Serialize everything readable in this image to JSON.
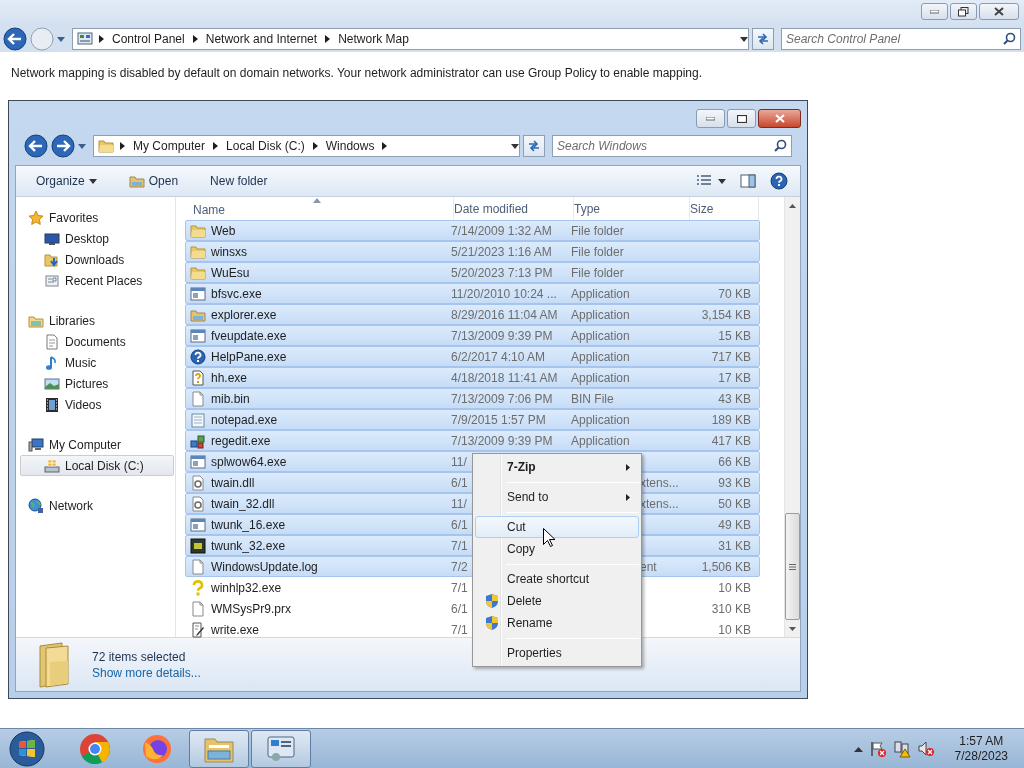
{
  "address_bar": {
    "crumbs": [
      "Control Panel",
      "Network and Internet",
      "Network Map"
    ]
  },
  "search": {
    "placeholder": "Search Control Panel"
  },
  "message": "Network mapping is disabled by default on domain networks. Your network administrator can use Group Policy to enable mapping.",
  "explorer": {
    "address_bar": {
      "crumbs": [
        "My Computer",
        "Local Disk (C:)",
        "Windows"
      ]
    },
    "search": {
      "placeholder": "Search Windows"
    },
    "toolbar": [
      {
        "label": "Organize",
        "kind": "menu"
      },
      {
        "label": "Open",
        "kind": "open"
      },
      {
        "label": "New folder",
        "kind": "plain"
      }
    ],
    "sidebar": [
      {
        "label": "Favorites",
        "kind": "star",
        "selected": false,
        "children": [
          {
            "label": "Desktop",
            "kind": "desktop",
            "selected": false
          },
          {
            "label": "Downloads",
            "kind": "downloads",
            "selected": false
          },
          {
            "label": "Recent Places",
            "kind": "recent",
            "selected": false
          }
        ]
      },
      {
        "label": "Libraries",
        "kind": "library",
        "selected": false,
        "children": [
          {
            "label": "Documents",
            "kind": "documents",
            "selected": false
          },
          {
            "label": "Music",
            "kind": "music",
            "selected": false
          },
          {
            "label": "Pictures",
            "kind": "pictures",
            "selected": false
          },
          {
            "label": "Videos",
            "kind": "videos",
            "selected": false
          }
        ]
      },
      {
        "label": "My Computer",
        "kind": "computer",
        "selected": false,
        "children": [
          {
            "label": "Local Disk (C:)",
            "kind": "disk",
            "selected": true
          }
        ]
      },
      {
        "label": "Network",
        "kind": "network",
        "selected": false
      }
    ],
    "columns": [
      {
        "label": "Name",
        "sorted": true
      },
      {
        "label": "Date modified",
        "sorted": false
      },
      {
        "label": "Type",
        "sorted": false
      },
      {
        "label": "Size",
        "sorted": false
      }
    ],
    "rows": [
      {
        "name": "Web",
        "date": "7/14/2009 1:32 AM",
        "type": "File folder",
        "kind": "folder",
        "selected": true
      },
      {
        "name": "winsxs",
        "date": "5/21/2023 1:16 AM",
        "type": "File folder",
        "kind": "folder",
        "selected": true
      },
      {
        "name": "WuEsu",
        "date": "5/20/2023 7:13 PM",
        "type": "File folder",
        "kind": "folder",
        "selected": true
      },
      {
        "name": "bfsvc.exe",
        "date": "11/20/2010 10:24 ...",
        "type": "Application",
        "size": "70 KB",
        "kind": "app",
        "selected": true
      },
      {
        "name": "explorer.exe",
        "date": "8/29/2016 11:04 AM",
        "type": "Application",
        "size": "3,154 KB",
        "kind": "explorer",
        "selected": true
      },
      {
        "name": "fveupdate.exe",
        "date": "7/13/2009 9:39 PM",
        "type": "Application",
        "size": "15 KB",
        "kind": "app",
        "selected": true
      },
      {
        "name": "HelpPane.exe",
        "date": "6/2/2017 4:10 AM",
        "type": "Application",
        "size": "717 KB",
        "kind": "help",
        "selected": true
      },
      {
        "name": "hh.exe",
        "date": "4/18/2018 11:41 AM",
        "type": "Application",
        "size": "17 KB",
        "kind": "hh",
        "selected": true
      },
      {
        "name": "mib.bin",
        "date": "7/13/2009 7:06 PM",
        "type": "BIN File",
        "size": "43 KB",
        "kind": "file",
        "selected": true
      },
      {
        "name": "notepad.exe",
        "date": "7/9/2015 1:57 PM",
        "type": "Application",
        "size": "189 KB",
        "kind": "notepad",
        "selected": true
      },
      {
        "name": "regedit.exe",
        "date": "7/13/2009 9:39 PM",
        "type": "Application",
        "size": "417 KB",
        "kind": "regedit",
        "selected": true
      },
      {
        "name": "splwow64.exe",
        "date": "11/",
        "size": "66 KB",
        "kind": "app",
        "selected": true
      },
      {
        "name": "twain.dll",
        "date": "6/1",
        "type": "xtens...",
        "size": "93 KB",
        "kind": "dll",
        "selected": true
      },
      {
        "name": "twain_32.dll",
        "date": "11/",
        "type": "xtens...",
        "size": "50 KB",
        "kind": "dll",
        "selected": true
      },
      {
        "name": "twunk_16.exe",
        "date": "6/1",
        "size": "49 KB",
        "kind": "app",
        "selected": true
      },
      {
        "name": "twunk_32.exe",
        "date": "7/1",
        "size": "31 KB",
        "kind": "console",
        "selected": true
      },
      {
        "name": "WindowsUpdate.log",
        "date": "7/2",
        "type": "ent",
        "size": "1,506 KB",
        "kind": "file",
        "selected": true
      },
      {
        "name": "winhlp32.exe",
        "date": "7/1",
        "size": "10 KB",
        "kind": "question",
        "selected": false
      },
      {
        "name": "WMSysPr9.prx",
        "date": "6/1",
        "size": "310 KB",
        "kind": "file",
        "selected": false
      },
      {
        "name": "write.exe",
        "date": "7/1",
        "size": "10 KB",
        "kind": "write",
        "selected": false
      }
    ],
    "details": {
      "count": "72 items selected",
      "link": "Show more details..."
    }
  },
  "context_menu": [
    {
      "kind": "item",
      "label": "7-Zip",
      "bold": true,
      "submenu": true,
      "shield": false,
      "highlighted": false
    },
    {
      "kind": "separator"
    },
    {
      "kind": "item",
      "label": "Send to",
      "bold": false,
      "submenu": true,
      "shield": false,
      "highlighted": false
    },
    {
      "kind": "separator"
    },
    {
      "kind": "item",
      "label": "Cut",
      "bold": false,
      "submenu": false,
      "shield": false,
      "highlighted": true
    },
    {
      "kind": "item",
      "label": "Copy",
      "bold": false,
      "submenu": false,
      "shield": false,
      "highlighted": false
    },
    {
      "kind": "separator"
    },
    {
      "kind": "item",
      "label": "Create shortcut",
      "bold": false,
      "submenu": false,
      "shield": false,
      "highlighted": false
    },
    {
      "kind": "item",
      "label": "Delete",
      "bold": false,
      "submenu": false,
      "shield": true,
      "highlighted": false
    },
    {
      "kind": "item",
      "label": "Rename",
      "bold": false,
      "submenu": false,
      "shield": true,
      "highlighted": false
    },
    {
      "kind": "separator"
    },
    {
      "kind": "item",
      "label": "Properties",
      "bold": false,
      "submenu": false,
      "shield": false,
      "highlighted": false
    }
  ],
  "taskbar": {
    "apps": [
      {
        "kind": "start",
        "running": false
      },
      {
        "kind": "chrome",
        "running": false
      },
      {
        "kind": "firefox",
        "running": false
      },
      {
        "kind": "explorer",
        "running": true
      },
      {
        "kind": "control",
        "running": true
      }
    ],
    "clock": {
      "time": "1:57 AM",
      "date": "7/28/2023"
    }
  }
}
